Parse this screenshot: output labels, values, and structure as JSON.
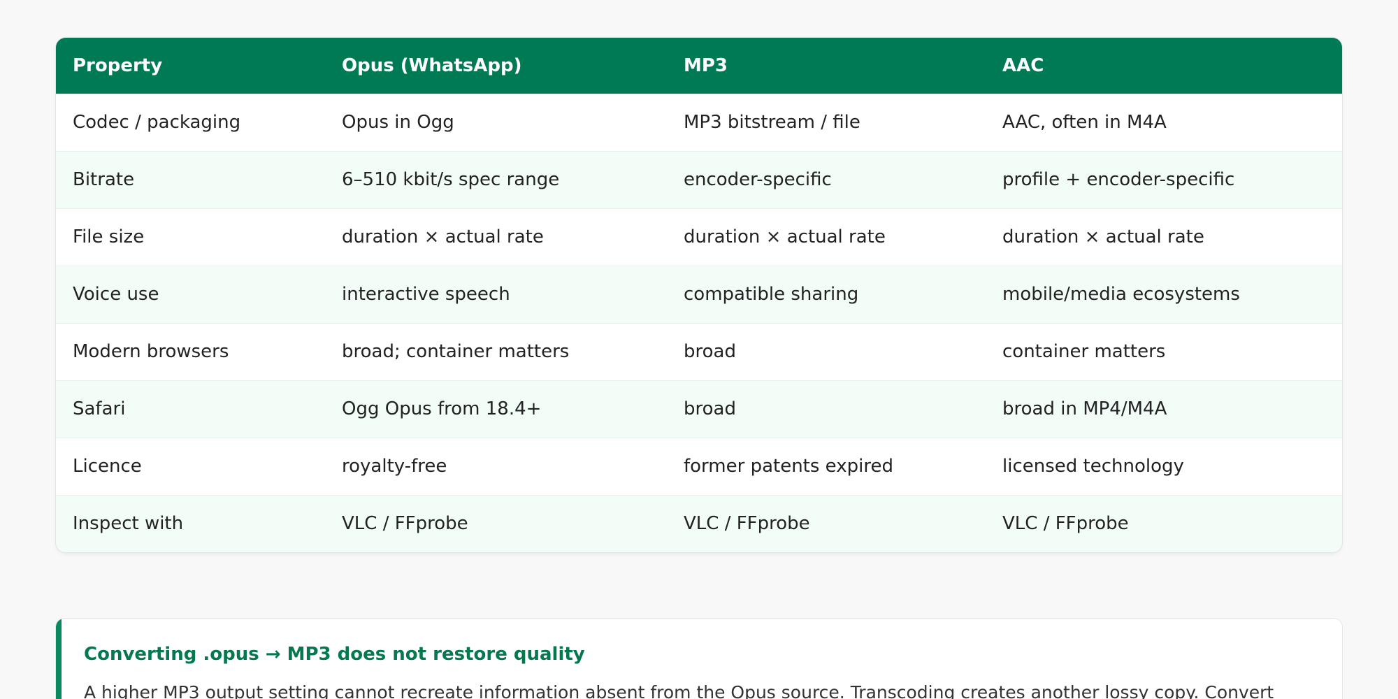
{
  "table": {
    "headers": [
      "Property",
      "Opus (WhatsApp)",
      "MP3",
      "AAC"
    ],
    "rows": [
      [
        "Codec / packaging",
        "Opus in Ogg",
        "MP3 bitstream / file",
        "AAC, often in M4A"
      ],
      [
        "Bitrate",
        "6–510 kbit/s spec range",
        "encoder-specific",
        "profile + encoder-specific"
      ],
      [
        "File size",
        "duration × actual rate",
        "duration × actual rate",
        "duration × actual rate"
      ],
      [
        "Voice use",
        "interactive speech",
        "compatible sharing",
        "mobile/media ecosystems"
      ],
      [
        "Modern browsers",
        "broad; container matters",
        "broad",
        "container matters"
      ],
      [
        "Safari",
        "Ogg Opus from 18.4+",
        "broad",
        "broad in MP4/M4A"
      ],
      [
        "Licence",
        "royalty-free",
        "former patents expired",
        "licensed technology"
      ],
      [
        "Inspect with",
        "VLC / FFprobe",
        "VLC / FFprobe",
        "VLC / FFprobe"
      ]
    ]
  },
  "note": {
    "title": "Converting .opus → MP3 does not restore quality",
    "body": "A higher MP3 output setting cannot recreate information absent from the Opus source. Transcoding creates another lossy copy. Convert"
  },
  "colors": {
    "header_bg": "#007a55",
    "accent": "#0a8a5c",
    "alt_row": "#f3fdf8"
  }
}
